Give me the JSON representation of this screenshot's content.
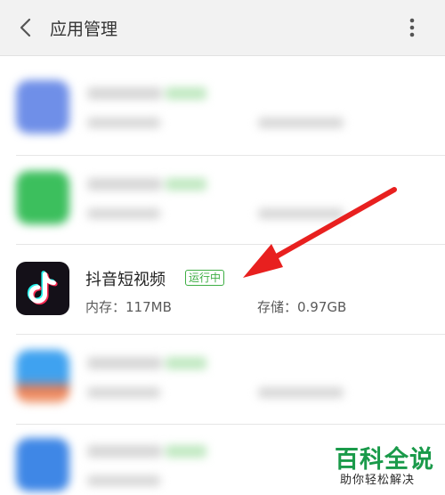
{
  "header": {
    "title": "应用管理",
    "back_icon": "chevron-left-icon",
    "more_icon": "more-vertical-icon"
  },
  "apps": [
    {
      "name": "抖音短视频",
      "status": "运行中",
      "memory": "内存：117MB",
      "storage": "存储：0.97GB",
      "icon": "tiktok-icon"
    }
  ],
  "watermark": {
    "main": "百科全说",
    "sub": "助你轻松解决"
  },
  "colors": {
    "header_bg": "#f2f2f2",
    "badge_green": "#3eae44",
    "arrow_red": "#e8201f",
    "watermark_green": "#1a9a4a",
    "tiktok_bg": "#141018"
  }
}
